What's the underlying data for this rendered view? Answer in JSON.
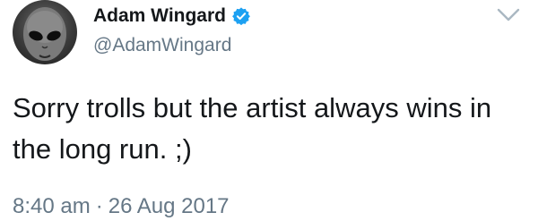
{
  "author": {
    "display_name": "Adam Wingard",
    "handle": "@AdamWingard",
    "verified": true
  },
  "tweet": {
    "text": "Sorry trolls but the artist always wins in the long run. ;)",
    "time": "8:40 am",
    "separator": "·",
    "date": "26 Aug 2017"
  },
  "icons": {
    "verified": "verified-badge-icon",
    "menu": "chevron-down-icon"
  },
  "colors": {
    "verified": "#1da1f2",
    "secondary_text": "#657786",
    "primary_text": "#14171a",
    "caret": "#aab8c2"
  }
}
